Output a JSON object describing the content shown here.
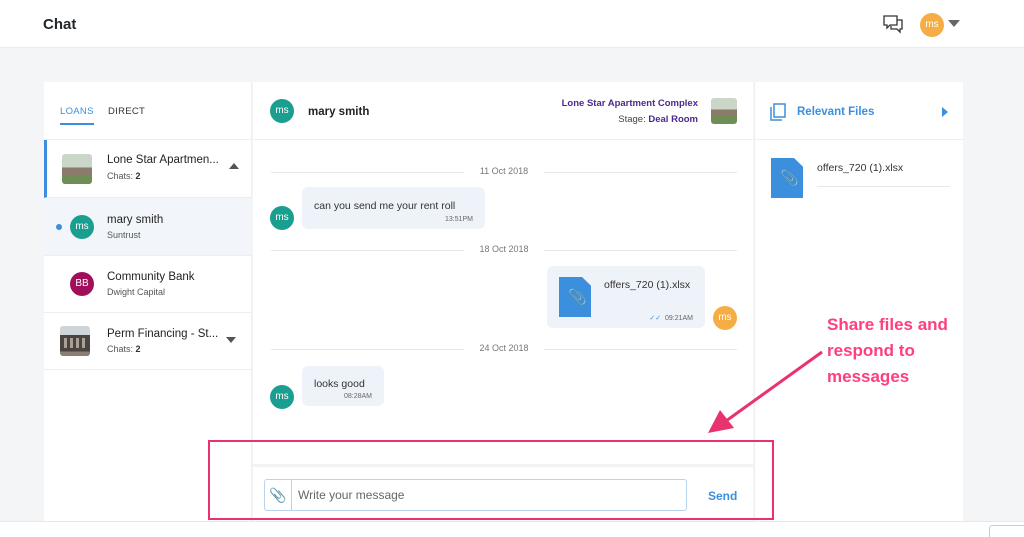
{
  "header": {
    "title": "Chat",
    "avatar_initials": "ms"
  },
  "tabs": [
    {
      "label": "LOANS"
    },
    {
      "label": "DIRECT"
    }
  ],
  "conversations": [
    {
      "name": "Lone Star Apartmen...",
      "sub_label": "Chats:",
      "sub_value": "2"
    },
    {
      "name": "mary smith",
      "sub": "Suntrust",
      "initials": "ms"
    },
    {
      "name": "Community Bank",
      "sub": "Dwight Capital",
      "initials": "BB"
    },
    {
      "name": "Perm Financing - St...",
      "sub_label": "Chats:",
      "sub_value": "2"
    }
  ],
  "chat": {
    "contact_initials": "ms",
    "contact_name": "mary smith",
    "project": "Lone Star Apartment Complex",
    "stage_label": "Stage:",
    "stage_value": "Deal Room",
    "messages": [
      {
        "date": "11 Oct 2018",
        "text": "can you send me your rent roll",
        "time": "13:51PM",
        "initials": "ms"
      },
      {
        "date": "18 Oct 2018",
        "file": "offers_720 (1).xlsx",
        "time": "09:21AM",
        "initials": "ms"
      },
      {
        "date": "24 Oct 2018",
        "text": "looks good",
        "time": "08:28AM",
        "initials": "ms"
      }
    ],
    "composer": {
      "placeholder": "Write your message",
      "send_label": "Send"
    }
  },
  "files_panel": {
    "title": "Relevant Files",
    "files": [
      {
        "name": "offers_720 (1).xlsx"
      }
    ]
  },
  "annotation": {
    "line1": "Share files and",
    "line2": "respond to",
    "line3": "messages"
  },
  "colors": {
    "accent": "#3b8fdc",
    "teal": "#1a9e8f",
    "orange": "#f5ad45",
    "purple": "#a0105a",
    "annotation": "#e8336f"
  }
}
